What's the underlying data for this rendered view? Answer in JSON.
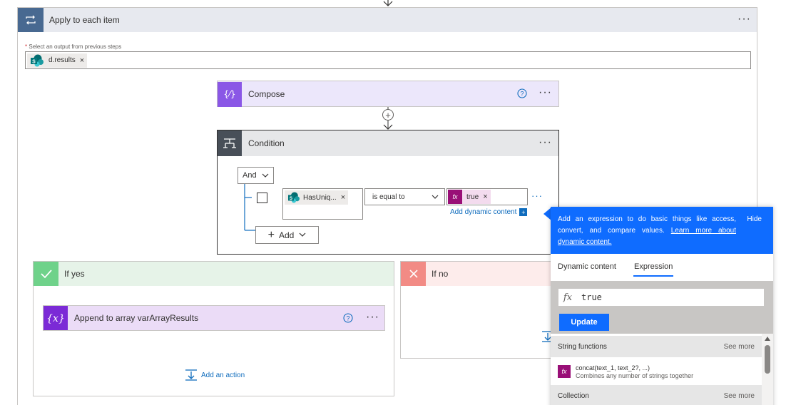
{
  "outer": {
    "title": "Apply to each item",
    "select_label": "Select an output from previous steps",
    "chip": "d.results"
  },
  "compose": {
    "title": "Compose"
  },
  "condition": {
    "title": "Condition",
    "and_label": "And",
    "field_chip": "HasUniq...",
    "operator": "is equal to",
    "value_chip": "true",
    "add_dynamic": "Add dynamic content",
    "add_label": "Add"
  },
  "yes": {
    "title": "If yes",
    "action_title": "Append to array varArrayResults",
    "add_action": "Add an action"
  },
  "no": {
    "title": "If no"
  },
  "panel": {
    "header_text": "Add an expression to do basic things like access, convert, and compare values.",
    "learn_more": "Learn more about dynamic content.",
    "hide": "Hide",
    "tab_dynamic": "Dynamic content",
    "tab_expression": "Expression",
    "expression_value": "true",
    "update_label": "Update",
    "sections": [
      {
        "name": "String functions",
        "see_more": "See more"
      },
      {
        "name": "Collection",
        "see_more": "See more"
      }
    ],
    "function": {
      "signature": "concat(text_1, text_2?, ...)",
      "description": "Combines any number of strings together"
    }
  },
  "colors": {
    "accent_blue": "#0f6cff",
    "compose_purple": "#8a57e6",
    "variable_purple": "#7b2ad6",
    "condition_dark": "#484f58",
    "yes_green": "#6fd28a",
    "no_red": "#f28b85",
    "expression_magenta": "#990f77"
  }
}
